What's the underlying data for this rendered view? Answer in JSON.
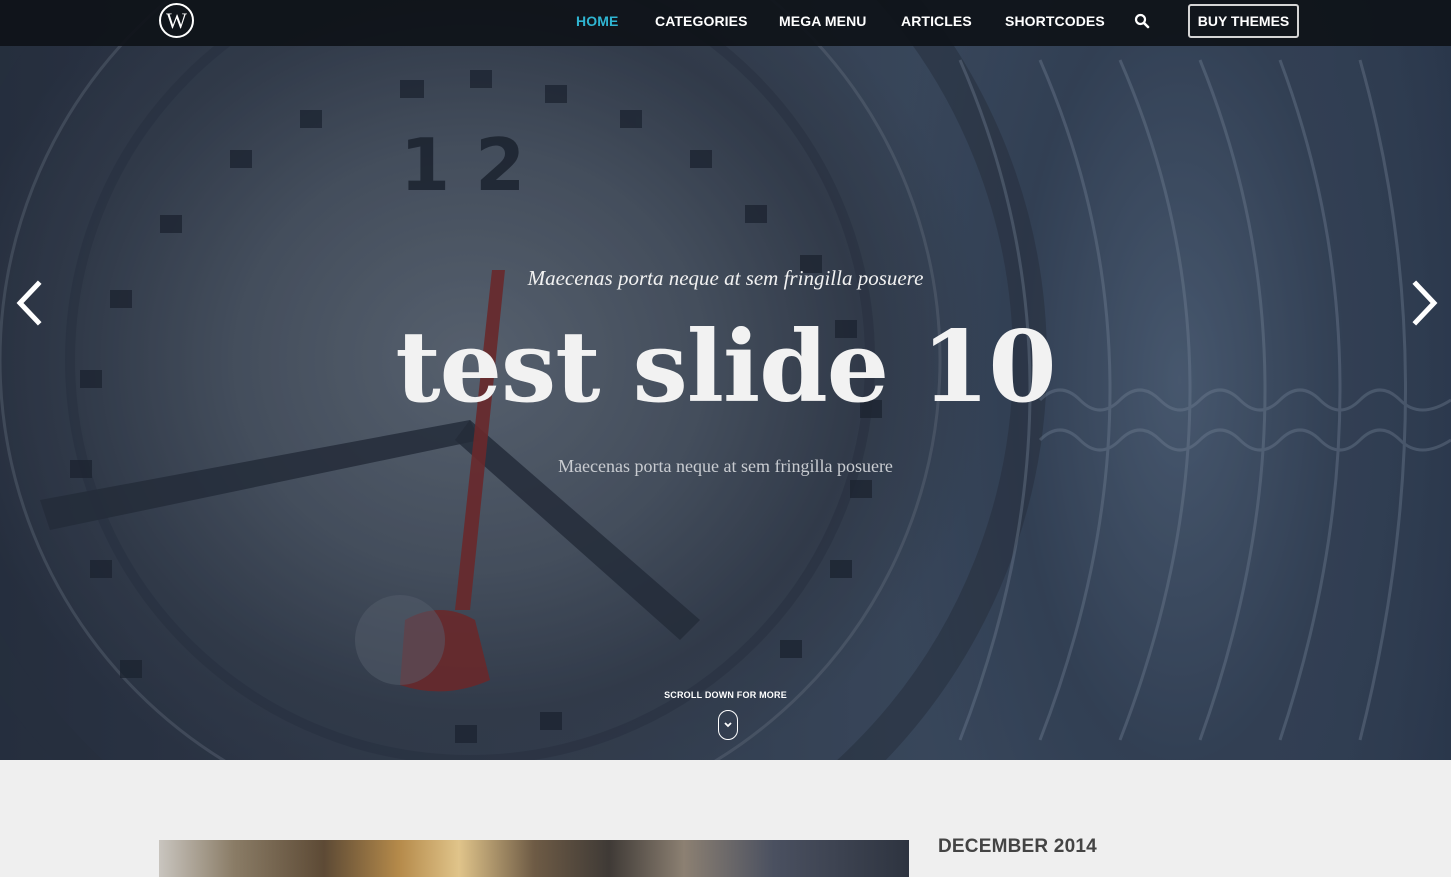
{
  "nav": {
    "logo_text": "W",
    "items": [
      {
        "label": "HOME",
        "active": true
      },
      {
        "label": "CATEGORIES"
      },
      {
        "label": "MEGA MENU"
      },
      {
        "label": "ARTICLES"
      },
      {
        "label": "SHORTCODES"
      }
    ],
    "search_icon": "search-icon",
    "buy_label": "BUY THEMES"
  },
  "slide": {
    "kicker": "Maecenas porta neque at sem fringilla posuere",
    "title": "test slide 10",
    "subtitle": "Maecenas porta neque at sem fringilla posuere",
    "prev_icon": "chevron-left-icon",
    "next_icon": "chevron-right-icon",
    "scroll_label": "SCROLL DOWN FOR MORE",
    "scroll_icon": "chevron-down-icon"
  },
  "sidebar": {
    "heading": "DECEMBER 2014"
  },
  "colors": {
    "accent": "#2fb5d2",
    "nav_bg": "#0e1218",
    "page_bg": "#efefef",
    "heading_text": "#444444"
  }
}
